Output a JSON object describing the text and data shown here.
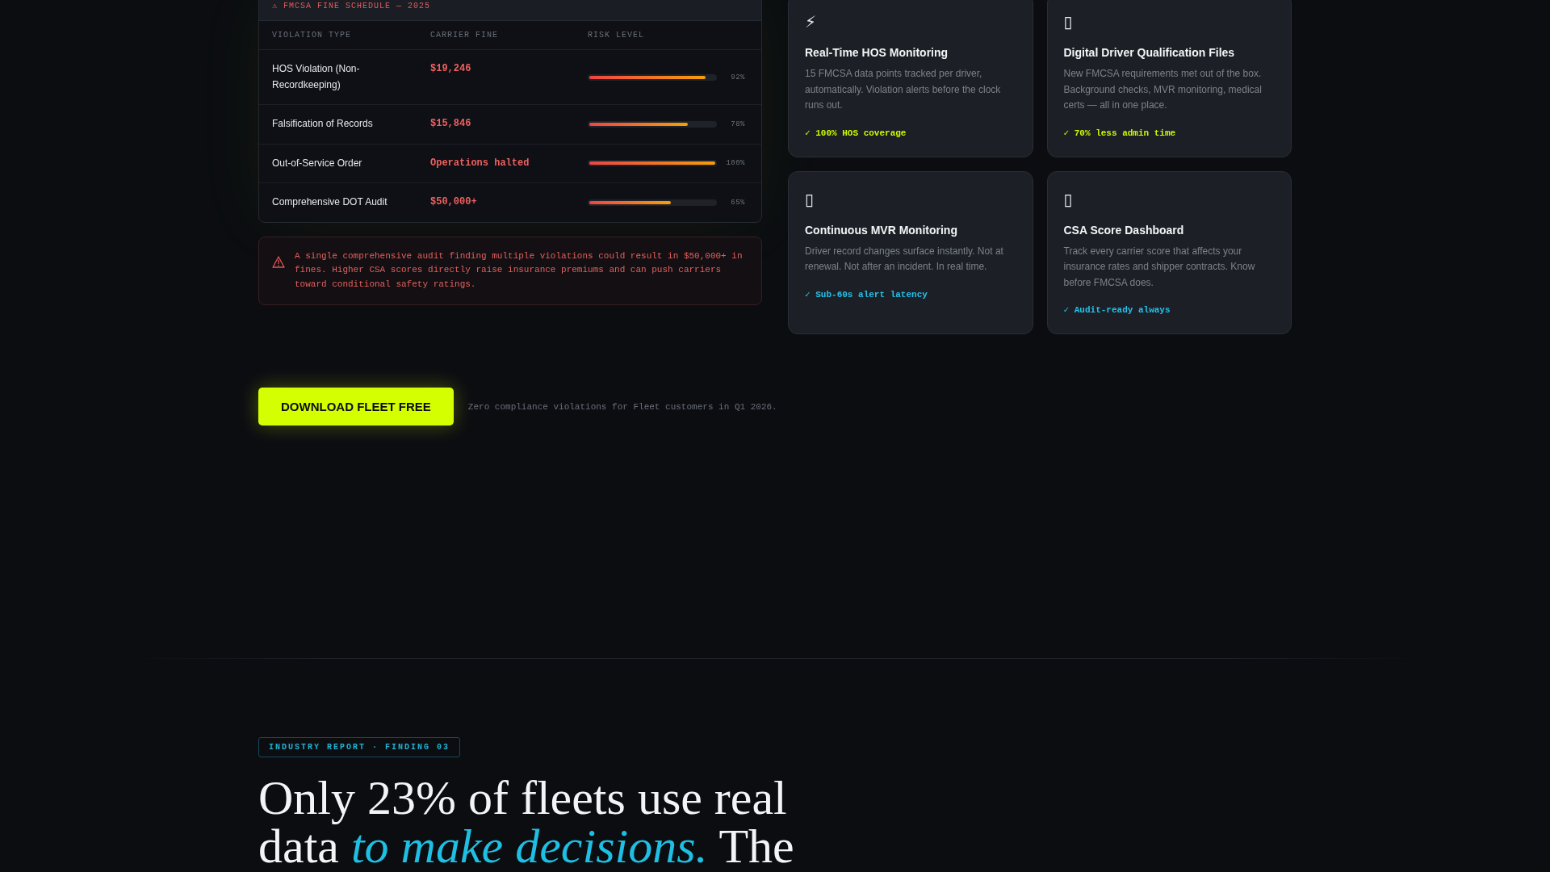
{
  "fine_table": {
    "title": "⚠ FMCSA FINE SCHEDULE — 2025",
    "columns": [
      "VIOLATION TYPE",
      "CARRIER FINE",
      "RISK LEVEL"
    ],
    "rows": [
      {
        "violation": "HOS Violation (Non-Recordkeeping)",
        "fine": "$19,246",
        "level": 0.92,
        "reading": "92%"
      },
      {
        "violation": "Falsification of Records",
        "fine": "$15,846",
        "level": 0.78,
        "reading": "78%"
      },
      {
        "violation": "Out-of-Service Order",
        "fine": "Operations halted",
        "level": 1,
        "reading": "100%"
      },
      {
        "violation": "Comprehensive DOT Audit",
        "fine": "$50,000+",
        "level": 0.65,
        "reading": "65%"
      }
    ]
  },
  "alert": {
    "text": "A single comprehensive audit finding multiple violations could result in $50,000+ in fines. Higher CSA scores directly raise insurance premiums and can push carriers toward conditional safety ratings."
  },
  "cards": [
    {
      "icon": "⚡",
      "title": "Real-Time HOS Monitoring",
      "description": "15 FMCSA data points tracked per driver, automatically. Violation alerts before the clock runs out.",
      "highlight": "✓ 100% HOS coverage",
      "color": "#d0f700"
    },
    {
      "icon": "▯",
      "title": "Digital Driver Qualification Files",
      "description": "New FMCSA requirements met out of the box. Background checks, MVR monitoring, medical certs — all in one place.",
      "highlight": "✓ 70% less admin time",
      "color": "#d0f700"
    },
    {
      "icon": "▯",
      "title": "Continuous MVR Monitoring",
      "description": "Driver record changes surface instantly. Not at renewal. Not after an incident. In real time.",
      "highlight": "✓ Sub-60s alert latency",
      "color": "#25c2ea"
    },
    {
      "icon": "▯",
      "title": "CSA Score Dashboard",
      "description": "Track every carrier score that affects your insurance rates and shipper contracts. Know before FMCSA does.",
      "highlight": "✓ Audit-ready always",
      "color": "#25c2ea"
    }
  ],
  "cta": {
    "button": "DOWNLOAD FLEET FREE",
    "note": "Zero compliance violations for Fleet customers in Q1 2026."
  },
  "report": {
    "badge": "INDUSTRY REPORT · FINDING 03",
    "heading": "Only 23% of fleets use real data *to make decisions.* The"
  }
}
